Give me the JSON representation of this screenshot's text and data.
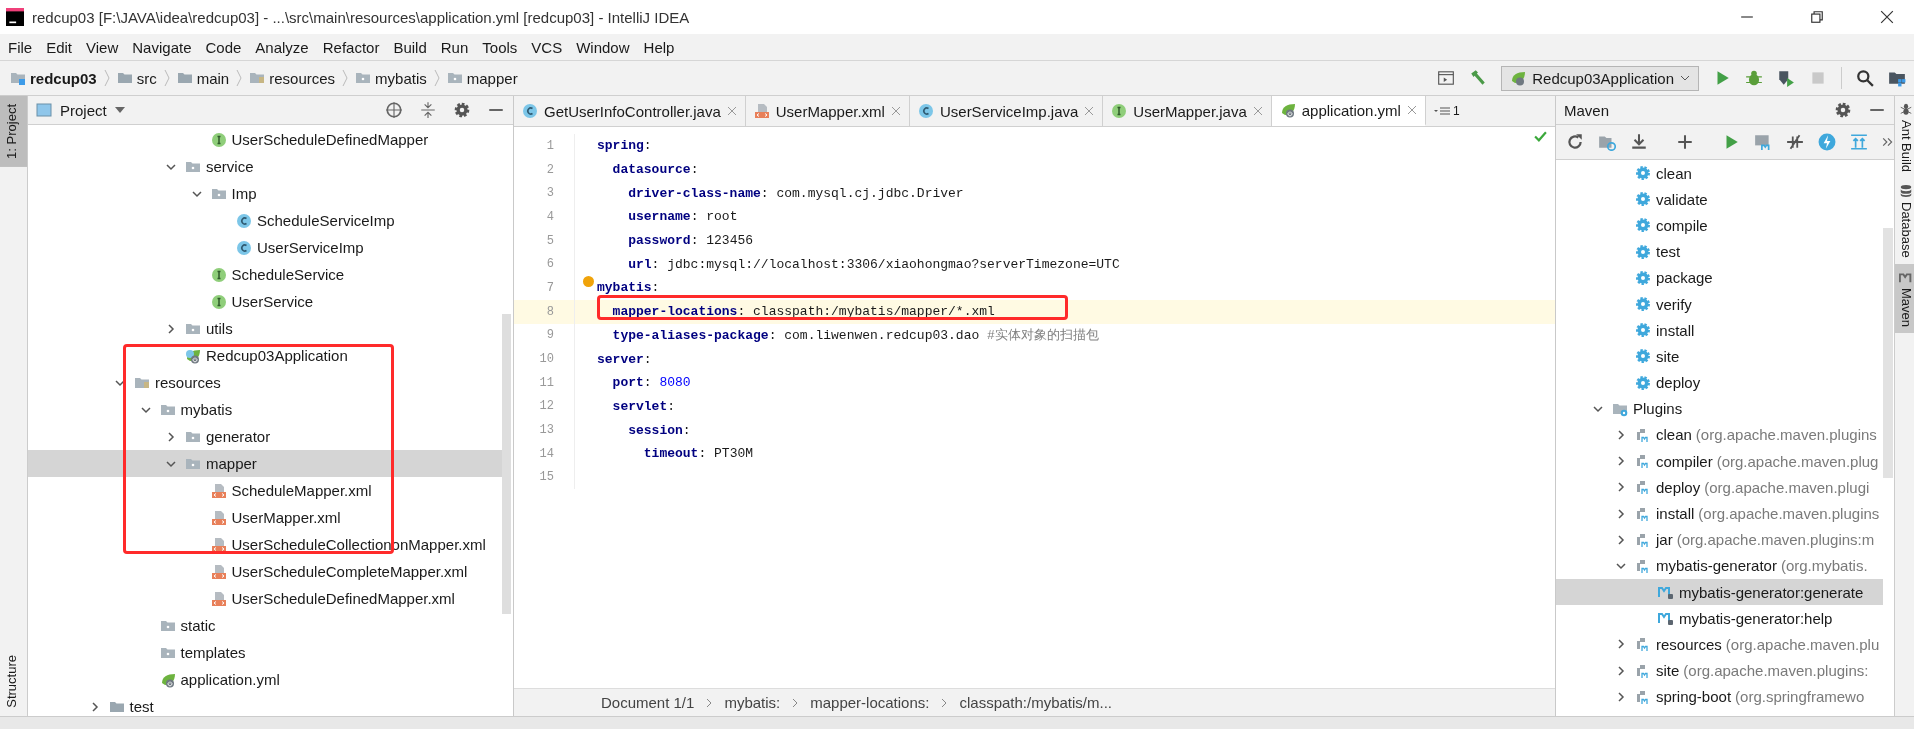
{
  "window": {
    "title": "redcup03 [F:\\JAVA\\idea\\redcup03] - ...\\src\\main\\resources\\application.yml [redcup03] - IntelliJ IDEA"
  },
  "menu": [
    "File",
    "Edit",
    "View",
    "Navigate",
    "Code",
    "Analyze",
    "Refactor",
    "Build",
    "Run",
    "Tools",
    "VCS",
    "Window",
    "Help"
  ],
  "breadcrumbs": [
    {
      "label": "redcup03",
      "kind": "module"
    },
    {
      "label": "src",
      "kind": "folder"
    },
    {
      "label": "main",
      "kind": "folder"
    },
    {
      "label": "resources",
      "kind": "resources"
    },
    {
      "label": "mybatis",
      "kind": "package"
    },
    {
      "label": "mapper",
      "kind": "package"
    }
  ],
  "run_config": "Redcup03Application",
  "left_strip": [
    {
      "label": "1: Project",
      "selected": true
    },
    {
      "label": "Structure",
      "selected": false
    }
  ],
  "right_strip": [
    {
      "label": "Ant Build",
      "kind": "ant",
      "selected": false
    },
    {
      "label": "Database",
      "kind": "database",
      "selected": false
    },
    {
      "label": "Maven",
      "kind": "maven",
      "selected": true
    }
  ],
  "project": {
    "title": "Project",
    "tree": [
      {
        "children": [
          {
            "children": [
              {
                "children": [
                  {
                    "children": [
                      {
                        "children": [
                          {
                            "label": "UserScheduleDefinedMapper",
                            "kind": "interface",
                            "selected": false
                          }
                        ]
                      },
                      {
                        "label": "service",
                        "kind": "package",
                        "expanded": true,
                        "selected": false,
                        "children": [
                          {
                            "label": "Imp",
                            "kind": "package",
                            "expanded": true,
                            "selected": false,
                            "children": [
                              {
                                "label": "ScheduleServiceImp",
                                "kind": "class",
                                "selected": false
                              },
                              {
                                "label": "UserServiceImp",
                                "kind": "class",
                                "selected": false
                              }
                            ]
                          },
                          {
                            "label": "ScheduleService",
                            "kind": "interface",
                            "selected": false
                          },
                          {
                            "label": "UserService",
                            "kind": "interface",
                            "selected": false
                          }
                        ]
                      },
                      {
                        "label": "utils",
                        "kind": "package",
                        "expanded": false,
                        "selected": false
                      },
                      {
                        "label": "Redcup03Application",
                        "kind": "spring",
                        "selected": false
                      }
                    ]
                  }
                ]
              },
              {
                "label": "resources",
                "kind": "resources",
                "expanded": true,
                "selected": false,
                "children": [
                  {
                    "label": "mybatis",
                    "kind": "package",
                    "expanded": true,
                    "selected": false,
                    "children": [
                      {
                        "label": "generator",
                        "kind": "package",
                        "expanded": false,
                        "selected": false
                      },
                      {
                        "label": "mapper",
                        "kind": "package",
                        "expanded": true,
                        "selected": true,
                        "children": [
                          {
                            "label": "ScheduleMapper.xml",
                            "kind": "xml",
                            "selected": false
                          },
                          {
                            "label": "UserMapper.xml",
                            "kind": "xml",
                            "selected": false
                          },
                          {
                            "label": "UserScheduleCollectiononMapper.xml",
                            "kind": "xml",
                            "selected": false
                          },
                          {
                            "label": "UserScheduleCompleteMapper.xml",
                            "kind": "xml",
                            "selected": false
                          },
                          {
                            "label": "UserScheduleDefinedMapper.xml",
                            "kind": "xml",
                            "selected": false
                          }
                        ]
                      }
                    ]
                  },
                  {
                    "label": "static",
                    "kind": "package",
                    "selected": false
                  },
                  {
                    "label": "templates",
                    "kind": "package",
                    "selected": false
                  },
                  {
                    "label": "application.yml",
                    "kind": "yml",
                    "selected": false
                  }
                ]
              }
            ]
          },
          {
            "label": "test",
            "kind": "folder",
            "expanded": false,
            "selected": false
          }
        ]
      }
    ]
  },
  "tabs": [
    {
      "label": "GetUserInfoController.java",
      "kind": "class",
      "selected": false
    },
    {
      "label": "UserMapper.xml",
      "kind": "xml",
      "selected": false
    },
    {
      "label": "UserServiceImp.java",
      "kind": "class",
      "selected": false
    },
    {
      "label": "UserMapper.java",
      "kind": "interface",
      "selected": false
    },
    {
      "label": "application.yml",
      "kind": "yml",
      "selected": true
    }
  ],
  "hidden_tabs": "1",
  "editor": {
    "lines": [
      {
        "number": "1",
        "current": false,
        "bulb": false,
        "segments": [
          {
            "kind": "key",
            "text": "spring"
          },
          {
            "kind": "plain",
            "text": ":"
          }
        ]
      },
      {
        "number": "2",
        "current": false,
        "bulb": false,
        "segments": [
          {
            "kind": "key",
            "text": "  datasource"
          },
          {
            "kind": "plain",
            "text": ":"
          }
        ]
      },
      {
        "number": "3",
        "current": false,
        "bulb": false,
        "segments": [
          {
            "kind": "key",
            "text": "    driver-class-name"
          },
          {
            "kind": "plain",
            "text": ": com.mysql.cj.jdbc.Driver"
          }
        ]
      },
      {
        "number": "4",
        "current": false,
        "bulb": false,
        "segments": [
          {
            "kind": "key",
            "text": "    username"
          },
          {
            "kind": "plain",
            "text": ": root"
          }
        ]
      },
      {
        "number": "5",
        "current": false,
        "bulb": false,
        "segments": [
          {
            "kind": "key",
            "text": "    password"
          },
          {
            "kind": "plain",
            "text": ": 123456"
          }
        ]
      },
      {
        "number": "6",
        "current": false,
        "bulb": false,
        "segments": [
          {
            "kind": "key",
            "text": "    url"
          },
          {
            "kind": "plain",
            "text": ": jdbc:mysql://localhost:3306/xiaohongmao?serverTimezone=UTC"
          }
        ]
      },
      {
        "number": "7",
        "current": false,
        "bulb": true,
        "segments": [
          {
            "kind": "key",
            "text": "mybatis"
          },
          {
            "kind": "plain",
            "text": ":"
          }
        ]
      },
      {
        "number": "8",
        "current": true,
        "bulb": false,
        "segments": [
          {
            "kind": "key",
            "text": "  mapper-locations"
          },
          {
            "kind": "plain",
            "text": ": classpath:/mybatis/mapper/*.xml"
          }
        ]
      },
      {
        "number": "9",
        "current": false,
        "bulb": false,
        "segments": [
          {
            "kind": "key",
            "text": "  type-aliases-package"
          },
          {
            "kind": "plain",
            "text": ": com.liwenwen.redcup03.dao "
          },
          {
            "kind": "comment",
            "text": "#实体对象的扫描包"
          }
        ]
      },
      {
        "number": "10",
        "current": false,
        "bulb": false,
        "segments": [
          {
            "kind": "key",
            "text": "server"
          },
          {
            "kind": "plain",
            "text": ":"
          }
        ]
      },
      {
        "number": "11",
        "current": false,
        "bulb": false,
        "segments": [
          {
            "kind": "key",
            "text": "  port"
          },
          {
            "kind": "plain",
            "text": ": "
          },
          {
            "kind": "number",
            "text": "8080"
          }
        ]
      },
      {
        "number": "12",
        "current": false,
        "bulb": false,
        "segments": [
          {
            "kind": "key",
            "text": "  servlet"
          },
          {
            "kind": "plain",
            "text": ":"
          }
        ]
      },
      {
        "number": "13",
        "current": false,
        "bulb": false,
        "segments": [
          {
            "kind": "key",
            "text": "    session"
          },
          {
            "kind": "plain",
            "text": ":"
          }
        ]
      },
      {
        "number": "14",
        "current": false,
        "bulb": false,
        "segments": [
          {
            "kind": "key",
            "text": "      timeout"
          },
          {
            "kind": "plain",
            "text": ": PT30M"
          }
        ]
      },
      {
        "number": "15",
        "current": false,
        "bulb": false
      }
    ],
    "path": [
      "Document 1/1",
      "mybatis:",
      "mapper-locations:",
      "classpath:/mybatis/m..."
    ]
  },
  "maven": {
    "title": "Maven",
    "tree": [
      {
        "children": [
          {
            "children": [
              {
                "label": "clean",
                "kind": "goal",
                "selected": false
              },
              {
                "label": "validate",
                "kind": "goal",
                "selected": false
              },
              {
                "label": "compile",
                "kind": "goal",
                "selected": false
              },
              {
                "label": "test",
                "kind": "goal",
                "selected": false
              },
              {
                "label": "package",
                "kind": "goal",
                "selected": false
              },
              {
                "label": "verify",
                "kind": "goal",
                "selected": false
              },
              {
                "label": "install",
                "kind": "goal",
                "selected": false
              },
              {
                "label": "site",
                "kind": "goal",
                "selected": false
              },
              {
                "label": "deploy",
                "kind": "goal",
                "selected": false
              }
            ]
          },
          {
            "label": "Plugins",
            "kind": "plugins",
            "expanded": true,
            "selected": false,
            "children": [
              {
                "label": "clean",
                "detail": "(org.apache.maven.plugins",
                "kind": "plugin",
                "expanded": false,
                "selected": false
              },
              {
                "label": "compiler",
                "detail": "(org.apache.maven.plug",
                "kind": "plugin",
                "expanded": false,
                "selected": false
              },
              {
                "label": "deploy",
                "detail": "(org.apache.maven.plugi",
                "kind": "plugin",
                "expanded": false,
                "selected": false
              },
              {
                "label": "install",
                "detail": "(org.apache.maven.plugins",
                "kind": "plugin",
                "expanded": false,
                "selected": false
              },
              {
                "label": "jar",
                "detail": "(org.apache.maven.plugins:m",
                "kind": "plugin",
                "expanded": false,
                "selected": false
              },
              {
                "label": "mybatis-generator",
                "detail": "(org.mybatis.",
                "kind": "plugin",
                "expanded": true,
                "selected": false,
                "children": [
                  {
                    "label": "mybatis-generator:generate",
                    "kind": "mojo",
                    "selected": true
                  },
                  {
                    "label": "mybatis-generator:help",
                    "kind": "mojo",
                    "selected": false
                  }
                ]
              },
              {
                "label": "resources",
                "detail": "(org.apache.maven.plu",
                "kind": "plugin",
                "expanded": false,
                "selected": false
              },
              {
                "label": "site",
                "detail": "(org.apache.maven.plugins:",
                "kind": "plugin",
                "expanded": false,
                "selected": false
              },
              {
                "label": "spring-boot",
                "detail": "(org.springframewo",
                "kind": "plugin",
                "expanded": false,
                "selected": false
              }
            ]
          }
        ]
      }
    ]
  },
  "annotations": [
    {
      "kind": "rectangle",
      "color": "#ff2a2a"
    },
    {
      "kind": "rectangle",
      "color": "#ff2a2a"
    }
  ]
}
